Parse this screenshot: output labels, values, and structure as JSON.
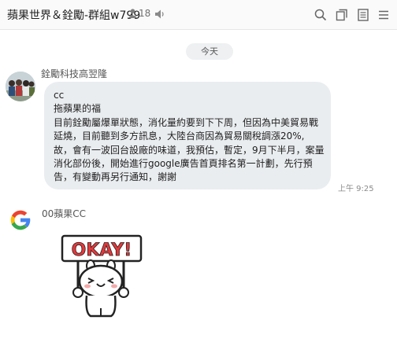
{
  "header": {
    "title": "蘋果世界＆銓勵-群組w799",
    "member_count": "18",
    "icons": [
      "person-icon",
      "speaker-icon",
      "search-icon",
      "copy-icon",
      "notes-icon",
      "menu-icon"
    ]
  },
  "chat": {
    "date_label": "今天",
    "messages": [
      {
        "sender": "銓勵科技高翌隆",
        "lines": [
          "cc",
          "拖蘋果的福",
          "目前銓勵屬爆單狀態，消化量約要到下下周，但因為中美貿易戰",
          "延燒，目前聽到多方訊息，大陸台商因為貿易關稅調漲20%,",
          "故，會有一波回台設廠的味道，我預估，暫定，9月下半月，案量",
          "消化部份後，開始進行google廣告首頁排名第一計劃，先行預",
          "告，有變動再另行通知，謝謝"
        ],
        "time": "上午 9:25"
      },
      {
        "sender": "00蘋果CC",
        "sticker_text": "OKAY!"
      }
    ]
  },
  "colors": {
    "bubble": "#eaedf0",
    "sticker_red": "#e5383b",
    "google_blue": "#4285F4",
    "google_red": "#EA4335",
    "google_yellow": "#FBBC05",
    "google_green": "#34A853"
  }
}
